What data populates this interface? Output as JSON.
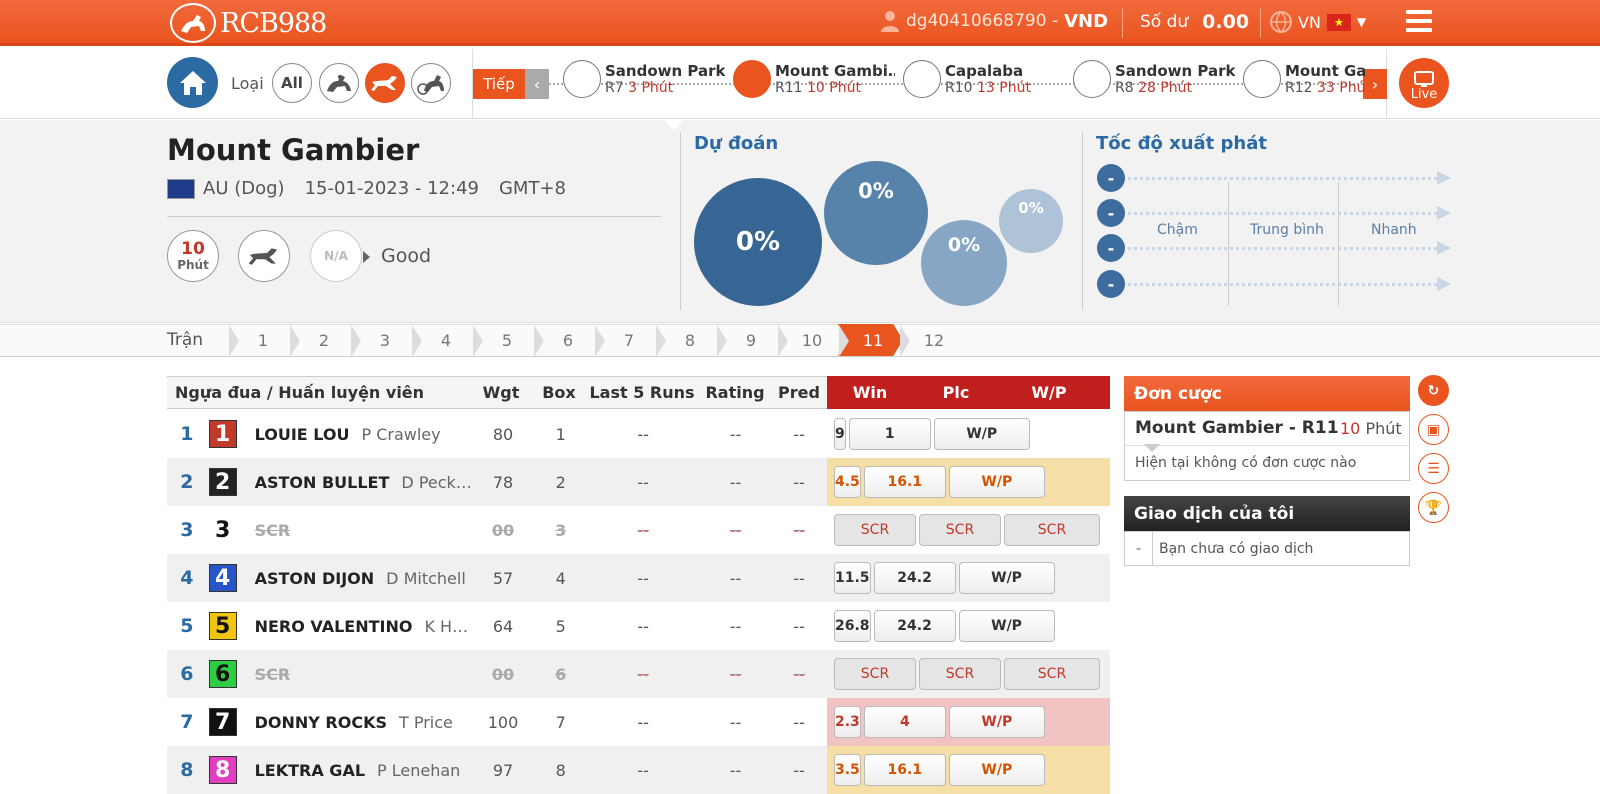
{
  "header": {
    "logo": "RCB988",
    "username": "dg40410668790 -",
    "currency": "VND",
    "balance_label": "Số dư",
    "balance": "0.00",
    "language": "VN"
  },
  "filter": {
    "label": "Loại",
    "all_label": "All"
  },
  "racebar": {
    "next_label": "Tiếp",
    "races": [
      {
        "name": "Sandown Park",
        "race": "R7",
        "time": "3 Phút",
        "active": false
      },
      {
        "name": "Mount Gambi…",
        "race": "R11",
        "time": "10 Phút",
        "active": true
      },
      {
        "name": "Capalaba",
        "race": "R10",
        "time": "13 Phút",
        "active": false
      },
      {
        "name": "Sandown Park",
        "race": "R8",
        "time": "28 Phút",
        "active": false
      },
      {
        "name": "Mount Ga",
        "race": "R12",
        "time": "33 Phú",
        "active": false
      }
    ],
    "live_label": "Live"
  },
  "meeting": {
    "venue": "Mount Gambier",
    "country": "AU (Dog)",
    "datetime": "15-01-2023 - 12:49",
    "timezone": "GMT+8",
    "minutes": "10",
    "minutes_unit": "Phút",
    "weather": "N/A",
    "track_condition": "Good"
  },
  "prediction": {
    "title": "Dự đoán",
    "bubbles": [
      "0%",
      "0%",
      "0%",
      "0%"
    ]
  },
  "speed": {
    "title": "Tốc độ xuất phát",
    "rows": [
      "-",
      "-",
      "-",
      "-"
    ],
    "labels": [
      "Chậm",
      "Trung bình",
      "Nhanh"
    ]
  },
  "stepper": {
    "label": "Trận",
    "steps": [
      "1",
      "2",
      "3",
      "4",
      "5",
      "6",
      "7",
      "8",
      "9",
      "10",
      "11",
      "12"
    ],
    "active": "11"
  },
  "table": {
    "headers": {
      "runner": "Ngựa đua / Huấn luyện viên",
      "wgt": "Wgt",
      "box": "Box",
      "last5": "Last 5 Runs",
      "rating": "Rating",
      "pred": "Pred",
      "win": "Win",
      "plc": "Plc",
      "wp": "W/P"
    },
    "rows": [
      {
        "no": "1",
        "name": "LOUIE LOU",
        "trainer": "P Crawley",
        "wgt": "80",
        "box": "1",
        "last5": "--",
        "rating": "--",
        "pred": "--",
        "win": "9",
        "plc": "1",
        "wp": "W/P",
        "color": "#c0392b"
      },
      {
        "no": "2",
        "name": "ASTON BULLET",
        "trainer": "D Peck…",
        "wgt": "78",
        "box": "2",
        "last5": "--",
        "rating": "--",
        "pred": "--",
        "win": "4.5",
        "plc": "16.1",
        "wp": "W/P",
        "color": "#222"
      },
      {
        "no": "3",
        "name": "SCR",
        "trainer": "",
        "wgt": "00",
        "box": "3",
        "last5": "--",
        "rating": "--",
        "pred": "--",
        "win": "SCR",
        "plc": "SCR",
        "wp": "SCR",
        "color": "#fff"
      },
      {
        "no": "4",
        "name": "ASTON DIJON",
        "trainer": "D Mitchell",
        "wgt": "57",
        "box": "4",
        "last5": "--",
        "rating": "--",
        "pred": "--",
        "win": "11.5",
        "plc": "24.2",
        "wp": "W/P",
        "color": "#2855c8"
      },
      {
        "no": "5",
        "name": "NERO VALENTINO",
        "trainer": "K H…",
        "wgt": "64",
        "box": "5",
        "last5": "--",
        "rating": "--",
        "pred": "--",
        "win": "26.8",
        "plc": "24.2",
        "wp": "W/P",
        "color": "#f1c40f"
      },
      {
        "no": "6",
        "name": "SCR",
        "trainer": "",
        "wgt": "00",
        "box": "6",
        "last5": "--",
        "rating": "--",
        "pred": "--",
        "win": "SCR",
        "plc": "SCR",
        "wp": "SCR",
        "color": "#2ecc40"
      },
      {
        "no": "7",
        "name": "DONNY ROCKS",
        "trainer": "T Price",
        "wgt": "100",
        "box": "7",
        "last5": "--",
        "rating": "--",
        "pred": "--",
        "win": "2.3",
        "plc": "4",
        "wp": "W/P",
        "color": "#111"
      },
      {
        "no": "8",
        "name": "LEKTRA GAL",
        "trainer": "P Lenehan",
        "wgt": "97",
        "box": "8",
        "last5": "--",
        "rating": "--",
        "pred": "--",
        "win": "3.5",
        "plc": "16.1",
        "wp": "W/P",
        "color": "#e040c0"
      }
    ]
  },
  "betslip": {
    "title": "Đơn cược",
    "race": "Mount Gambier - R11",
    "minutes": "10",
    "minutes_unit": "Phút",
    "empty_msg": "Hiện tại không có đơn cược nào"
  },
  "transactions": {
    "title": "Giao dịch của tôi",
    "dash": "-",
    "empty_msg": "Bạn chưa có giao dịch"
  }
}
